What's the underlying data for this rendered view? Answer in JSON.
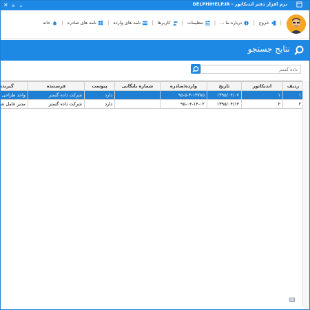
{
  "window": {
    "title": "نرم افزار دفتر اندیکاتور - DELPHIHELP.IR",
    "buttons": [
      "minimize",
      "maximize",
      "close"
    ]
  },
  "nav": {
    "items": [
      {
        "label": "خانه",
        "icon": "home-icon"
      },
      {
        "label": "نامه های صادره",
        "icon": "grid-icon"
      },
      {
        "label": "نامه های وارده",
        "icon": "list-icon"
      },
      {
        "label": "کاربرها",
        "icon": "users-icon"
      },
      {
        "label": "تنظیمات",
        "icon": "settings-icon"
      },
      {
        "label": "درباره ما ...",
        "icon": "info-icon"
      },
      {
        "label": "خروج",
        "icon": "exit-icon"
      }
    ]
  },
  "header": {
    "title": "نتایج جستجو"
  },
  "search": {
    "placeholder": "داده گستر"
  },
  "table": {
    "columns": [
      "ردیف",
      "اندیکاتور",
      "تاریخ",
      "وارده/صادره",
      "شماره بایگانی",
      "پیوست",
      "فرستنده",
      "گیرنده"
    ],
    "rows": [
      [
        "۱",
        "۱",
        "۱۳۹۵/۰۴/۰۷",
        "۹۵-۵-۳-۱۳۷۸۵",
        "",
        "دارد",
        "شرکت داده گستر",
        "واحد طراحی سایت"
      ],
      [
        "۲",
        "۲",
        "۱۳۹۵/۰۴/۱۴",
        "۹۵-۰۴-۱۴-۰۲",
        "",
        "دارد",
        "شرکت داده گستر",
        "مدیر عامل شرکت"
      ]
    ]
  },
  "colors": {
    "accent": "#1e88e5",
    "selected_row": "#1e7fd3"
  }
}
